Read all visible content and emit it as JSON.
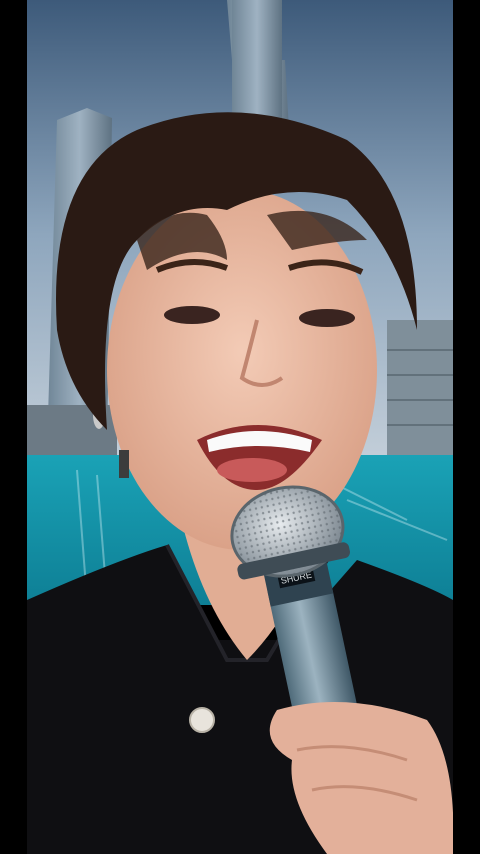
{
  "scene": {
    "description_tags": [
      "singer",
      "microphone",
      "city-backdrop",
      "fountain-pool"
    ],
    "colors": {
      "sky_top": "#3d5a7a",
      "sky_bottom": "#b9c7d3",
      "water": "#1f9fb0",
      "hair": "#2a1a14",
      "skin": "#e9b9a0",
      "shirt": "#0f0f12",
      "mic_body": "#6e8c9c",
      "mic_grille": "#c9ced2"
    },
    "microphone_label": "SHURE"
  }
}
